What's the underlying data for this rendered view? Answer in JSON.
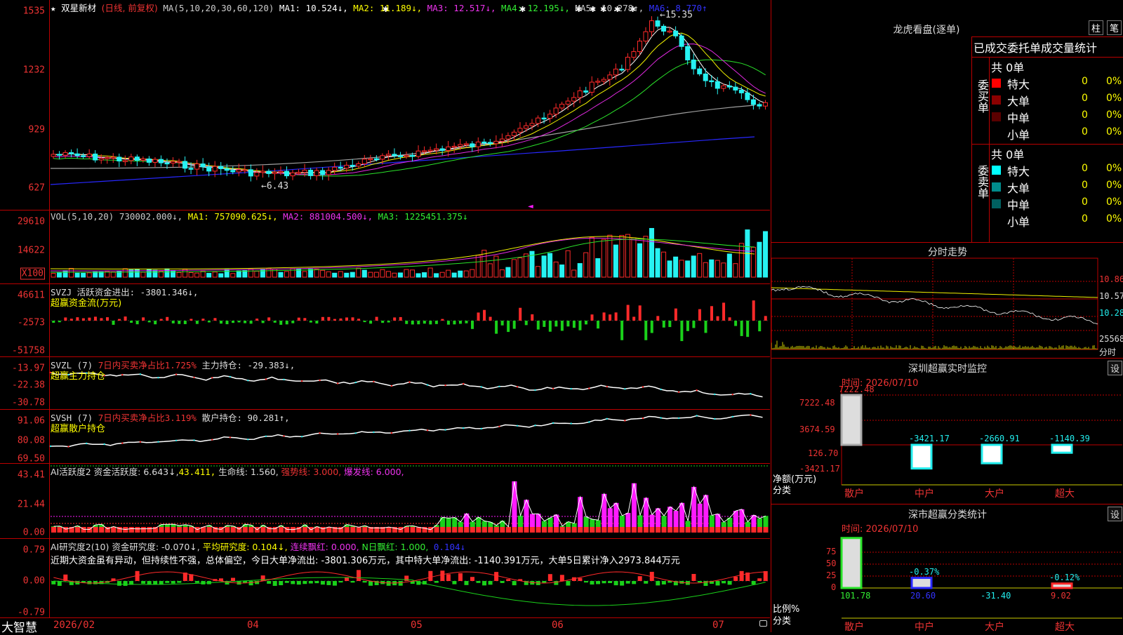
{
  "colors": {
    "up": "#ff2a2a",
    "down": "#27f2f2",
    "ma1": "#ffffff",
    "ma2": "#f2f200",
    "ma3": "#e32ae3",
    "ma4": "#2ae32a",
    "ma5": "#a0a0a0",
    "ma6": "#2828ff",
    "grid": "#b00000",
    "green": "#1ad11a",
    "magenta": "#ff1aff"
  },
  "main": {
    "stock_name": "双星新材",
    "mode": "(日线, 前复权)",
    "ma_label": "MA(5,10,20,30,60,120)",
    "ma1": "MA1: 10.524↓,",
    "ma2": "MA2: 11.189↓,",
    "ma3": "MA3: 12.517↓,",
    "ma4": "MA4: 12.195↓,",
    "ma5": "MA5: 10.278↑,",
    "ma6": "MA6: 8.770↑",
    "yticks": [
      "1535",
      "1232",
      "929",
      "627"
    ],
    "high_label": "15.35",
    "low_label": "6.43",
    "star": "★"
  },
  "vol": {
    "header": "VOL(5,10,20) 730002.000↓,",
    "ma1": "MA1: 757090.625↓,",
    "ma2": "MA2: 881004.500↓,",
    "ma3": "MA3: 1225451.375↓",
    "yticks": [
      "29610",
      "14622"
    ],
    "unit": "X100"
  },
  "svzj": {
    "header": "SVZJ  活跃资金进出: -3801.346↓,",
    "sub": "超赢资金流(万元)",
    "yticks": [
      "46611",
      "-2573",
      "-51758"
    ]
  },
  "svzl": {
    "h1": "SVZL (7) ",
    "h2": "7日内买卖净占比1.725%",
    "h3": " 主力持仓: -29.383↓,",
    "sub": "超赢主力持仓",
    "yticks": [
      "-13.97",
      "-22.38",
      "-30.78"
    ]
  },
  "svsh": {
    "h1": "SVSH (7) ",
    "h2": "7日内买卖净占比3.119%",
    "h3": " 散户持仓: 90.281↑,",
    "sub": "超赢散户持仓",
    "yticks": [
      "91.06",
      "80.08",
      "69.50"
    ]
  },
  "ai_active": {
    "h1": "AI活跃度2 资金活跃度: 6.643↓,",
    "h2": "43.411,",
    "h3": " 生命线: 1.560,",
    "h4": " 强势线: 3.000,",
    "h5": " 爆发线: 6.000,",
    "yticks": [
      "43.41",
      "21.44",
      "0.00"
    ]
  },
  "ai_research": {
    "h1": "AI研究度2(10) 资金研究度: -0.070↓,",
    "h2": " 平均研究度: 0.104↓,",
    "h3": " 连续飘红: 0.000,",
    "h4": " N日飘红: 1.000,",
    "h5": " 0.104↓",
    "comment": "近期大资金虽有异动，但持续性不强，总体偏空，今日大单净流出: -3801.306万元，其中特大单净流出: -1140.391万元，大单5日累计净入2973.844万元",
    "yticks": [
      "0.79",
      "0.00",
      "-0.79"
    ]
  },
  "dates": [
    "2026/02",
    "04",
    "05",
    "06",
    "07"
  ],
  "brand": "大智慧",
  "right": {
    "lhb_title": "龙虎看盘(逐单)",
    "tab_zhu": "柱",
    "tab_bi": "笔",
    "stat_header": "已成交委托单成交量统计",
    "buy_label": "委买单",
    "sell_label": "委卖单",
    "buy_total": "共 0单",
    "sell_total": "共 0单",
    "buy_rows": [
      {
        "name": "特大",
        "n": "0",
        "p": "0%",
        "c": "#ff0000"
      },
      {
        "name": "大单",
        "n": "0",
        "p": "0%",
        "c": "#8b0000"
      },
      {
        "name": "中单",
        "n": "0",
        "p": "0%",
        "c": "#5a0000"
      },
      {
        "name": "小单",
        "n": "0",
        "p": "0%",
        "c": "#000000"
      }
    ],
    "sell_rows": [
      {
        "name": "特大",
        "n": "0",
        "p": "0%",
        "c": "#00ffff"
      },
      {
        "name": "大单",
        "n": "0",
        "p": "0%",
        "c": "#008b8b"
      },
      {
        "name": "中单",
        "n": "0",
        "p": "0%",
        "c": "#006060"
      },
      {
        "name": "小单",
        "n": "0",
        "p": "0%",
        "c": "#000000"
      }
    ],
    "ts_title": "分时走势",
    "ts_ticks": [
      "10.86",
      "10.57",
      "10.28",
      "25568",
      "分时"
    ],
    "sz_title": "深圳超赢实时监控",
    "set": "设",
    "time_label": "时间: 2026/07/10",
    "sz_yticks": [
      "7222.48",
      "3674.59",
      "126.70",
      "-3421.17"
    ],
    "sz_axis_label1": "净额(万元)",
    "sz_axis_label2": "分类",
    "sz_bars": [
      {
        "cat": "散户",
        "value": "7222.48"
      },
      {
        "cat": "中户",
        "value": "-3421.17"
      },
      {
        "cat": "大户",
        "value": "-2660.91"
      },
      {
        "cat": "超大",
        "value": "-1140.39"
      }
    ],
    "fl_title": "深市超赢分类统计",
    "fl_yticks": [
      "75",
      "50",
      "25",
      "0"
    ],
    "fl_axis1": "比例%",
    "fl_axis2": "分类",
    "fl_bars": [
      {
        "cat": "散户",
        "pct": "101.78",
        "top": ""
      },
      {
        "cat": "中户",
        "pct": "20.60",
        "top": "-0.37%"
      },
      {
        "cat": "大户",
        "pct": "-31.40",
        "top": ""
      },
      {
        "cat": "超大",
        "pct": "9.02",
        "top": "-0.12%"
      }
    ]
  }
}
